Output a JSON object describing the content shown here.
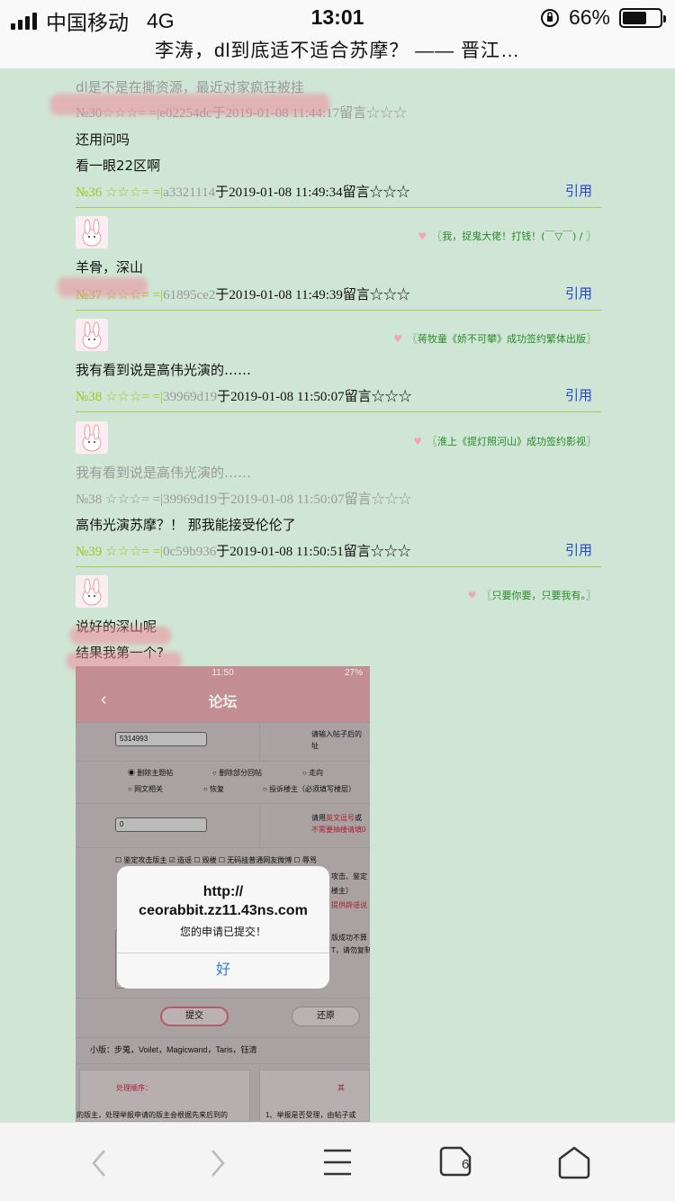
{
  "status_bar": {
    "carrier": "中国移动",
    "network": "4G",
    "time": "13:01",
    "battery": "66%",
    "battery_level": 0.66
  },
  "page_title": "李涛，dl到底适不适合苏摩？ —— 晋江…",
  "comments": [
    {
      "quote": "dl是不是在撕资源，最近对家疯狂被挂",
      "quote_meta": "№30☆☆☆= =|e02254dc于2019-01-08 11:44:17留言☆☆☆",
      "lines": [
        "还用问吗",
        "看一眼22区啊"
      ],
      "meta_num": "№36",
      "meta_stars": "☆☆☆= =|",
      "meta_id": "a3321114",
      "meta_time": "于2019-01-08 11:49:34留言☆☆☆",
      "reply": "引用"
    },
    {
      "signature": "〖我，捉鬼大佬！打钱！(￣▽￣) / 〗",
      "lines": [
        "羊骨，深山"
      ],
      "meta_num": "№37",
      "meta_stars": "☆☆☆= =|",
      "meta_id": "61895ce2",
      "meta_time": "于2019-01-08 11:49:39留言☆☆☆",
      "reply": "引用"
    },
    {
      "signature": "〖蒋牧童《娇不可攀》成功签约繁体出版〗",
      "lines": [
        "我有看到说是高伟光演的……"
      ],
      "meta_num": "№38",
      "meta_stars": "☆☆☆= =|",
      "meta_id": "39969d19",
      "meta_time": "于2019-01-08 11:50:07留言☆☆☆",
      "reply": "引用"
    },
    {
      "signature": "〖淮上《提灯照河山》成功签约影视〗",
      "quote": "我有看到说是高伟光演的……",
      "quote_meta": "№38 ☆☆☆= =|39969d19于2019-01-08 11:50:07留言☆☆☆",
      "lines": [
        "高伟光演苏摩？！ 那我能接受伦伦了"
      ],
      "meta_num": "№39",
      "meta_stars": "☆☆☆= =|",
      "meta_id": "0c59b936",
      "meta_time": "于2019-01-08 11:50:51留言☆☆☆",
      "reply": "引用"
    },
    {
      "signature": "〖只要你要，只要我有。〗",
      "lines": [
        "说好的深山呢",
        "结果我第一个?"
      ]
    }
  ],
  "embedded": {
    "status_time": "11:50",
    "status_batt": "27%",
    "title": "论坛",
    "field1": "5314993",
    "hint1": "请输入帖子后的",
    "hint1b": "址",
    "options": [
      "删除主题帖",
      "删除部分回帖",
      "走向",
      "网文相关",
      "恢复",
      "投诉楼主（必须填写楼层）"
    ],
    "field2": "0",
    "hint2a": "请用",
    "hint2b": "英文逗号",
    "hint2c": "或",
    "hint2d": "不需要抽楼请填0",
    "checks": [
      "鉴定攻击版主",
      "造谣",
      "毁楼",
      "无码挂普通网友微博",
      "辱骂"
    ],
    "right_frag1": "攻击、鉴定",
    "right_frag2": "提供辟谣说",
    "right_frag3": "楼主）",
    "right_frag4": "版成功不算",
    "right_frag5": "T，请勿复制",
    "dialog_url": "http://\nceorabbit.zz11.43ns.com",
    "dialog_msg": "您的申请已提交！",
    "dialog_ok": "好",
    "btn_submit": "提交",
    "btn_reset": "还原",
    "moderators": "小版：步蒐，Voilet，Magicwand，Taris，钰清",
    "order_title": "处理顺序：",
    "order_text": "的版主，处理举报申请的版主会根据先来后到的",
    "rule_title": "其",
    "rule_text": "1、举报是否受理，由帖子或"
  },
  "nav": {
    "back": "back-icon",
    "forward": "forward-icon",
    "menu": "menu-icon",
    "tabs": "tabs-icon",
    "tabs_count": "6",
    "home": "home-icon"
  }
}
